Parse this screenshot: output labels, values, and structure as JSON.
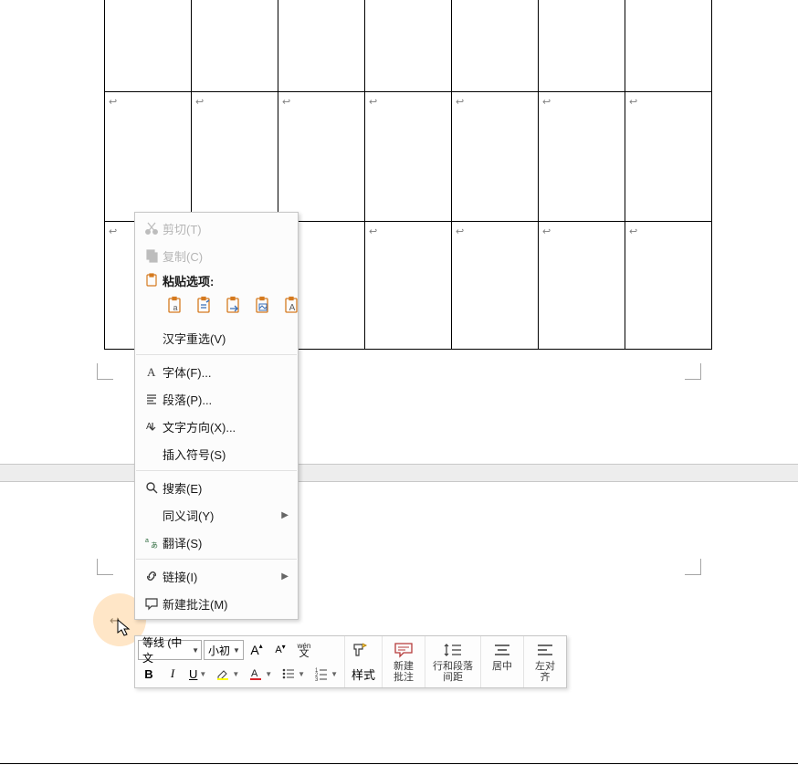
{
  "table": {
    "rows": 3,
    "cols": 7,
    "cell_marker": "↩"
  },
  "context_menu": {
    "cut": "剪切(T)",
    "copy": "复制(C)",
    "paste_header": "粘贴选项:",
    "reselect": "汉字重选(V)",
    "font": "字体(F)...",
    "paragraph": "段落(P)...",
    "text_direction": "文字方向(X)...",
    "insert_symbol": "插入符号(S)",
    "search": "搜索(E)",
    "synonyms": "同义词(Y)",
    "translate": "翻译(S)",
    "link": "链接(I)",
    "new_comment": "新建批注(M)"
  },
  "mini_toolbar": {
    "font_name": "等线 (中文",
    "font_size": "小初",
    "ruby_label": "wén",
    "ruby_char": "文",
    "styles": "样式",
    "new_comment_l1": "新建",
    "new_comment_l2": "批注",
    "linespacing_l1": "行和段落",
    "linespacing_l2": "间距",
    "center": "居中",
    "align_left_l1": "左对",
    "align_left_l2": "齐",
    "bold": "B",
    "italic": "I",
    "underline": "U",
    "grow": "A",
    "shrink": "A"
  },
  "page2_marker": "↩"
}
